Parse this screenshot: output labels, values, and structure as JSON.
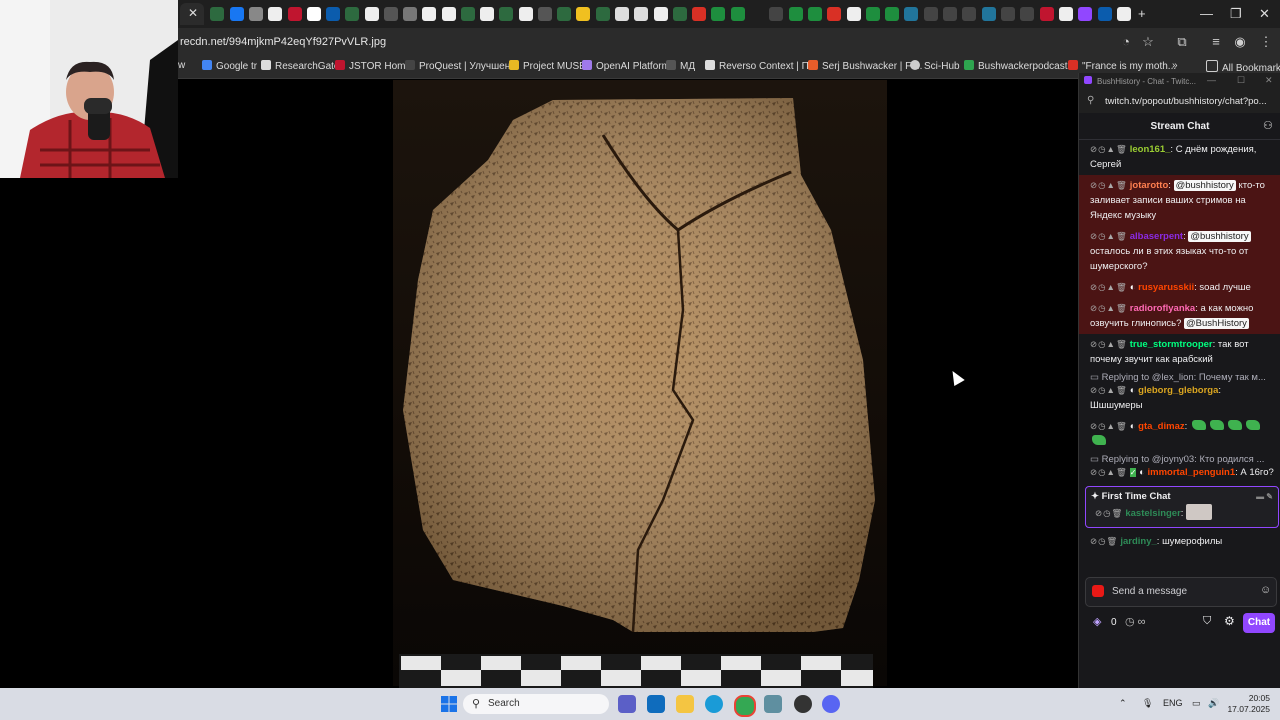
{
  "browser": {
    "url": "recdn.net/994mjkmP42eqYf927PvVLR.jpg",
    "bookmarks": [
      "w",
      "Google tr",
      "ResearchGate",
      "JSTOR Home",
      "ProQuest | Улучшен...",
      "Project MUSE",
      "OpenAI Platform",
      "МД",
      "Reverso Context | П...",
      "Serj Bushwacker | Fr...",
      "Sci-Hub",
      "Bushwackerpodcast...",
      "\"France is my moth...",
      "All Bookmarks"
    ]
  },
  "chat": {
    "window_title": "BushHistory - Chat - Twitc...",
    "url": "twitch.tv/popout/bushhistory/chat?po...",
    "header": "Stream Chat",
    "messages": [
      {
        "user": "leon161_",
        "color": "#9acd32",
        "text": "С днём рождения, Сергей",
        "highlight": false
      },
      {
        "user": "jotarotto",
        "color": "#ff7f50",
        "mention": "@bushhistory",
        "text": "кто-то заливает записи ваших стримов на Яндекс музыку",
        "highlight": true
      },
      {
        "user": "albaserpent",
        "color": "#8a2be2",
        "mention": "@bushhistory",
        "text": "осталось ли в этих языках что-то от шумерского?",
        "highlight": true
      },
      {
        "user": "rusyarusskii",
        "color": "#ff4500",
        "text": "soad лучше",
        "highlight": true
      },
      {
        "user": "radioroflyanka",
        "color": "#ff69b4",
        "text": "а как можно озвучить глинопись?",
        "mention_end": "@BushHistory",
        "highlight": true
      },
      {
        "user": "true_stormtrooper",
        "color": "#00ff7f",
        "text": "так вот почему звучит как арабский",
        "highlight": false
      }
    ],
    "reply1": "Replying to @lex_lion: Почему так м...",
    "msg_gleborg": {
      "user": "gleborg_gleborga",
      "color": "#daa520",
      "text": "Шшшумеры"
    },
    "msg_gta": {
      "user": "gta_dimaz",
      "color": "#ff4500"
    },
    "reply2": "Replying to @joyny03: Кто родился ...",
    "msg_immortal": {
      "user": "immortal_penguin1",
      "color": "#ff4500",
      "text": "А 16го?"
    },
    "first_time_label": "First Time Chat",
    "msg_kastel": {
      "user": "kastelsinger",
      "color": "#2e8b57"
    },
    "msg_jardiny": {
      "user": "jardiny_",
      "color": "#2e8b57",
      "text": "шумерофилы"
    },
    "input_placeholder": "Send a message",
    "points": "0",
    "chat_button": "Chat"
  },
  "taskbar": {
    "search_placeholder": "Search",
    "lang": "ENG",
    "time": "20:05",
    "date": "17.07.2025"
  }
}
